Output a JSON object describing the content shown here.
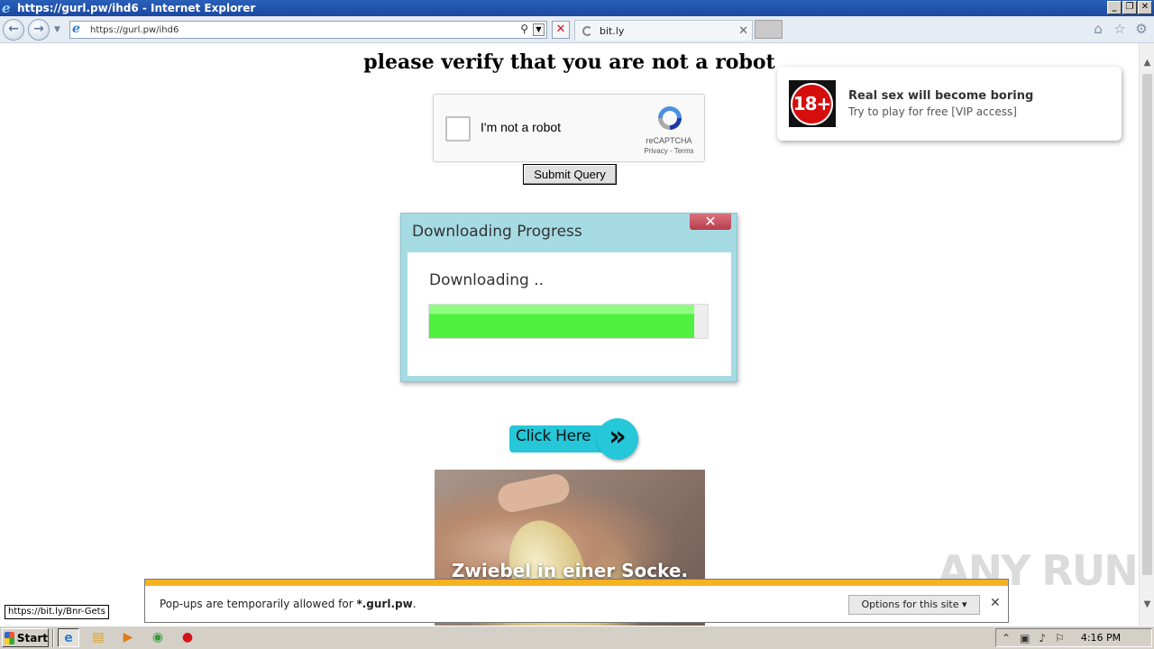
{
  "window": {
    "title": "https://gurl.pw/ihd6 - Internet Explorer",
    "controls": [
      "_",
      "❐",
      "✕"
    ]
  },
  "navbar": {
    "address_url": "https://gurl.pw/ihd6",
    "tab_title": "bit.ly"
  },
  "page": {
    "headline": "please verify that you are not a robot",
    "recaptcha": {
      "label": "I'm not a robot",
      "brand": "reCAPTCHA",
      "links": "Privacy - Terms"
    },
    "submit_label": "Submit Query",
    "download_dialog": {
      "title": "Downloading Progress",
      "close_glyph": "✕",
      "status_text": "Downloading ..",
      "progress_fraction": 0.95
    },
    "click_here": {
      "label": "Click Here",
      "arrow_glyph": "»"
    },
    "ad_image_caption": "Zwiebel in einer Socke.",
    "ad_18": {
      "badge": "18+",
      "title": "Real sex will become boring",
      "subtitle": "Try to play for free [VIP access]"
    }
  },
  "notification": {
    "text_prefix": "Pop-ups are temporarily allowed for ",
    "domain": "*.gurl.pw",
    "text_suffix": ".",
    "options_label": "Options for this site ▾",
    "close_glyph": "✕"
  },
  "status_url": "https://bit.ly/Bnr-Gets",
  "watermark": "ANY RUN",
  "taskbar": {
    "start_label": "Start",
    "clock": "4:16 PM"
  },
  "colors": {
    "titlebar": "#1c48a0",
    "progress_fill": "#4ff040",
    "dialog_border": "#a6dbe4",
    "notif_stripe": "#f5b321",
    "click_here": "#25c7d9",
    "badge_red": "#d60d0d"
  }
}
